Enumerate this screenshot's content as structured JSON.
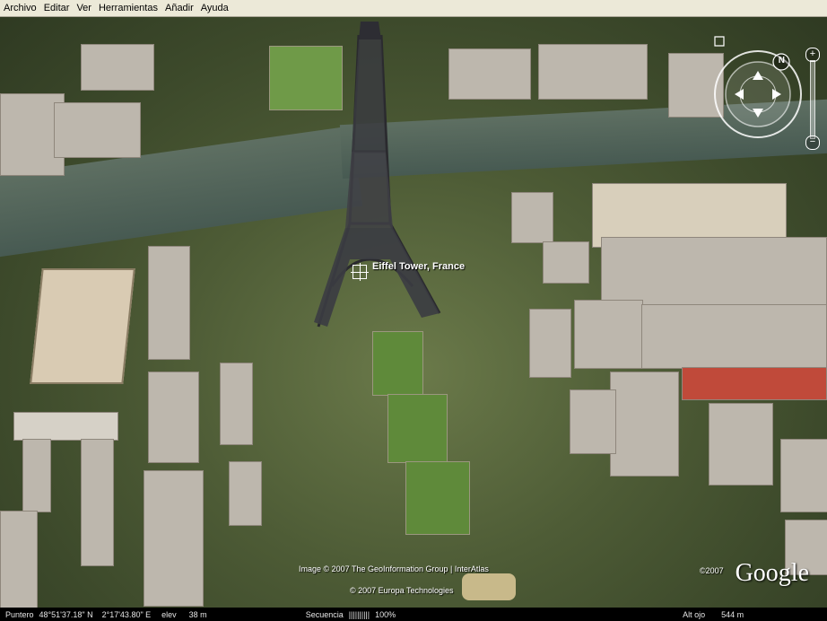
{
  "menu": [
    "Archivo",
    "Editar",
    "Ver",
    "Herramientas",
    "Añadir",
    "Ayuda"
  ],
  "placemark": {
    "label": "Eiffel Tower, France"
  },
  "copyrights": {
    "line1": "Image © 2007 The GeoInformation Group | InterAtlas",
    "line2": "© 2007 Europa Technologies",
    "logo_year": "©2007"
  },
  "logo": "Google",
  "nav": {
    "north_label": "N",
    "zoom_in": "+",
    "zoom_out": "−"
  },
  "status": {
    "pointer_label": "Puntero",
    "lat": "48°51'37.18\" N",
    "lon": "2°17'43.80\" E",
    "elev_label": "elev",
    "elev_value": "38 m",
    "stream_label": "Secuencia",
    "stream_bars": "||||||||||",
    "stream_pct": "100%",
    "eye_label": "Alt ojo",
    "eye_value": "544 m"
  }
}
